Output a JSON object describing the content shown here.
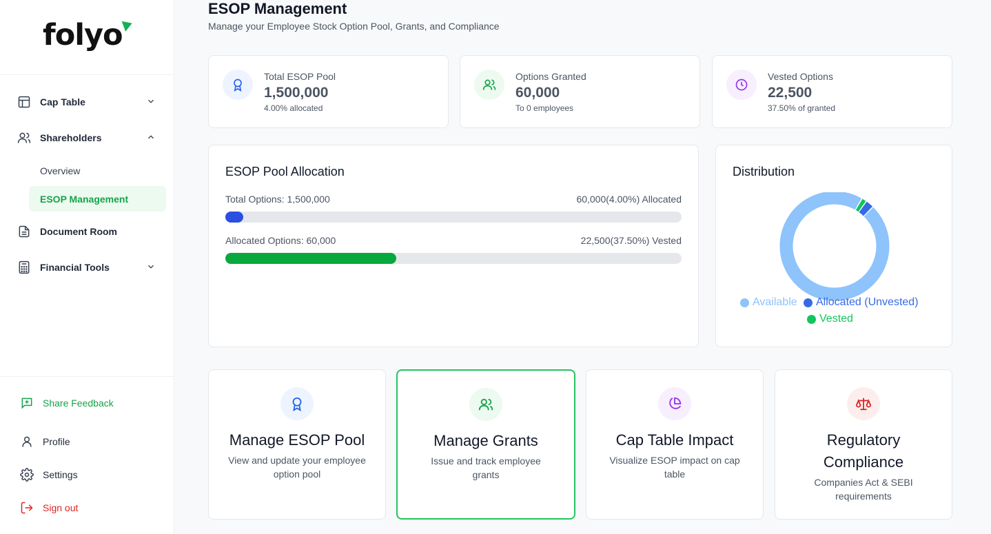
{
  "brand": {
    "name": "folyo",
    "accent": "#12b156"
  },
  "sidebar": {
    "nav": [
      {
        "label": "Cap Table",
        "icon": "table-icon",
        "chevron": "chevron-down-icon"
      },
      {
        "label": "Shareholders",
        "icon": "users-icon",
        "chevron": "chevron-up-icon"
      },
      {
        "label": "Document Room",
        "icon": "document-icon"
      },
      {
        "label": "Financial Tools",
        "icon": "calculator-icon",
        "chevron": "chevron-down-icon"
      }
    ],
    "sub_items": [
      {
        "label": "Overview",
        "active": false
      },
      {
        "label": "ESOP Management",
        "active": true
      }
    ],
    "bottom": [
      {
        "label": "Share Feedback",
        "icon": "feedback-icon"
      },
      {
        "label": "Profile",
        "icon": "user-icon"
      },
      {
        "label": "Settings",
        "icon": "gear-icon"
      },
      {
        "label": "Sign out",
        "icon": "sign-out-icon"
      }
    ]
  },
  "header": {
    "title": "ESOP Management",
    "subtitle": "Manage your Employee Stock Option Pool, Grants, and Compliance"
  },
  "stats": [
    {
      "label": "Total ESOP Pool",
      "value": "1,500,000",
      "sub": "4.00% allocated",
      "icon": "award-icon",
      "color": "#2563eb",
      "bg": "#eef4ff"
    },
    {
      "label": "Options Granted",
      "value": "60,000",
      "sub": "To 0 employees",
      "icon": "users-icon",
      "color": "#16a34a",
      "bg": "#ecfaf0"
    },
    {
      "label": "Vested Options",
      "value": "22,500",
      "sub": "37.50% of granted",
      "icon": "clock-icon",
      "color": "#9333ea",
      "bg": "#f7eefe"
    }
  ],
  "allocation": {
    "title": "ESOP Pool Allocation",
    "row1_left": "Total Options: 1,500,000",
    "row1_right": "60,000(4.00%) Allocated",
    "row1_fraction": 0.04,
    "row1_color": "#2b4fe0",
    "row2_left": "Allocated Options: 60,000",
    "row2_right": "22,500(37.50%) Vested",
    "row2_fraction": 0.375,
    "row2_color": "#07a83d"
  },
  "distribution": {
    "title": "Distribution",
    "legend": [
      {
        "label": "Available",
        "color": "#8ec3fb"
      },
      {
        "label": "Allocated (Unvested)",
        "color": "#356ae6"
      },
      {
        "label": "Vested",
        "color": "#12c55e"
      }
    ]
  },
  "chart_data": {
    "type": "pie",
    "title": "Distribution",
    "categories": [
      "Available",
      "Allocated (Unvested)",
      "Vested"
    ],
    "values": [
      1440000,
      37500,
      22500
    ],
    "colors": [
      "#8ec3fb",
      "#356ae6",
      "#12c55e"
    ],
    "legend": "bottom"
  },
  "actions": [
    {
      "title": "Manage ESOP Pool",
      "desc": "View and update your employee option pool",
      "icon": "award-icon",
      "color": "#2563eb",
      "bg": "#eef4ff"
    },
    {
      "title": "Manage Grants",
      "desc": "Issue and track employee grants",
      "icon": "users-icon",
      "color": "#16a34a",
      "bg": "#ecfaf0"
    },
    {
      "title": "Cap Table Impact",
      "desc": "Visualize ESOP impact on cap table",
      "icon": "pie-chart-icon",
      "color": "#9333ea",
      "bg": "#f7eefe"
    },
    {
      "title": "Regulatory Compliance",
      "desc": "Companies Act & SEBI requirements",
      "icon": "scale-icon",
      "color": "#dc2626",
      "bg": "#fdeeee"
    }
  ]
}
